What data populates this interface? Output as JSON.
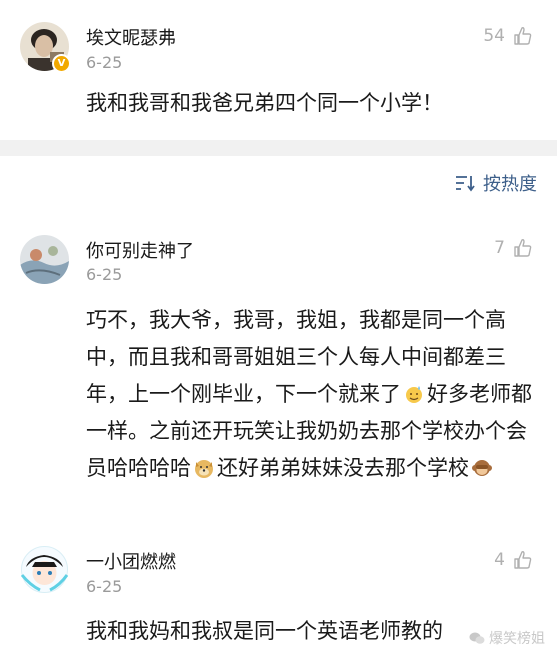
{
  "comments": [
    {
      "username": "埃文昵瑟弗",
      "date": "6-25",
      "likes": "54",
      "verified": true,
      "text": "我和我哥和我爸兄弟四个同一个小学！"
    },
    {
      "username": "你可别走神了",
      "date": "6-25",
      "likes": "7",
      "text_parts": [
        "巧不，我大爷，我哥，我姐，我都是同一个高中，而且我和哥哥姐姐三个人每人中间都差三年，上一个刚毕业，下一个就来了",
        "好多老师都一样。之前还开玩笑让我奶奶去那个学校办个会员哈哈哈哈",
        "还好弟弟妹妹没去那个学校"
      ],
      "emojis": [
        "sweat-smile-emoji",
        "doge-emoji",
        "monkey-emoji"
      ]
    },
    {
      "username": "一小团燃燃",
      "date": "6-25",
      "likes": "4",
      "text": "我和我妈和我叔是同一个英语老师教的"
    }
  ],
  "sort": {
    "label": "按热度",
    "icon": "sort-icon"
  },
  "watermark": {
    "text": "爆笑榜姐"
  },
  "colors": {
    "link_blue": "#3d5f8a",
    "verified_badge": "#f2a900",
    "divider": "#f1f1f1",
    "meta_gray": "#9a9a9a"
  }
}
